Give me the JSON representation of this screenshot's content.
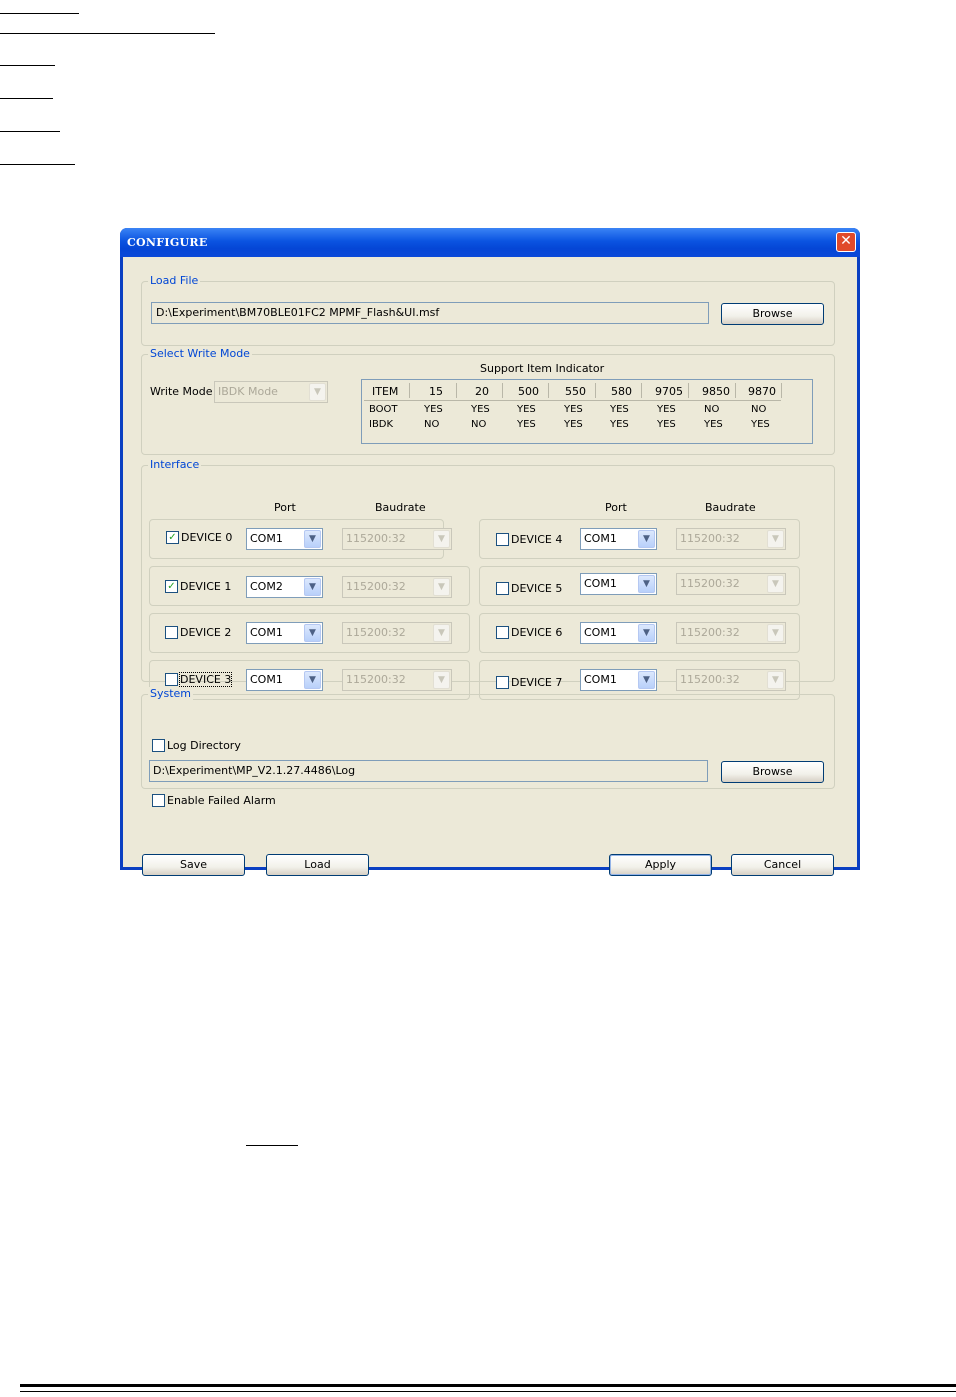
{
  "window": {
    "title": "CONFIGURE",
    "close_glyph": "✕"
  },
  "load_file": {
    "legend": "Load File",
    "path": "D:\\Experiment\\BM70BLE01FC2 MPMF_Flash&UI.msf",
    "browse_label": "Browse"
  },
  "write_mode": {
    "legend": "Select Write Mode",
    "label": "Write Mode",
    "value": "IBDK Mode",
    "indicator_title": "Support Item Indicator",
    "table": {
      "headers": [
        "ITEM",
        "15",
        "20",
        "500",
        "550",
        "580",
        "9705",
        "9850",
        "9870"
      ],
      "rows": [
        [
          "BOOT",
          "YES",
          "YES",
          "YES",
          "YES",
          "YES",
          "YES",
          "NO",
          "NO"
        ],
        [
          "IBDK",
          "NO",
          "NO",
          "YES",
          "YES",
          "YES",
          "YES",
          "YES",
          "YES"
        ]
      ]
    }
  },
  "interface": {
    "legend": "Interface",
    "port_header": "Port",
    "baud_header": "Baudrate",
    "devices": [
      {
        "label": "DEVICE 0",
        "checked": true,
        "port": "COM1",
        "baud": "115200:32"
      },
      {
        "label": "DEVICE 1",
        "checked": true,
        "port": "COM2",
        "baud": "115200:32"
      },
      {
        "label": "DEVICE 2",
        "checked": false,
        "port": "COM1",
        "baud": "115200:32"
      },
      {
        "label": "DEVICE 3",
        "checked": false,
        "port": "COM1",
        "baud": "115200:32"
      },
      {
        "label": "DEVICE 4",
        "checked": false,
        "port": "COM1",
        "baud": "115200:32"
      },
      {
        "label": "DEVICE 5",
        "checked": false,
        "port": "COM1",
        "baud": "115200:32"
      },
      {
        "label": "DEVICE 6",
        "checked": false,
        "port": "COM1",
        "baud": "115200:32"
      },
      {
        "label": "DEVICE 7",
        "checked": false,
        "port": "COM1",
        "baud": "115200:32"
      }
    ]
  },
  "system": {
    "legend": "System",
    "log_directory_label": "Log Directory",
    "log_directory_checked": false,
    "log_path": "D:\\Experiment\\MP_V2.1.27.4486\\Log",
    "browse_label": "Browse",
    "failed_alarm_label": "Enable Failed Alarm",
    "failed_alarm_checked": false
  },
  "buttons": {
    "save": "Save",
    "load": "Load",
    "apply": "Apply",
    "cancel": "Cancel"
  },
  "icons": {
    "combo_arrow": "chevron-down-icon",
    "check": "✓"
  }
}
